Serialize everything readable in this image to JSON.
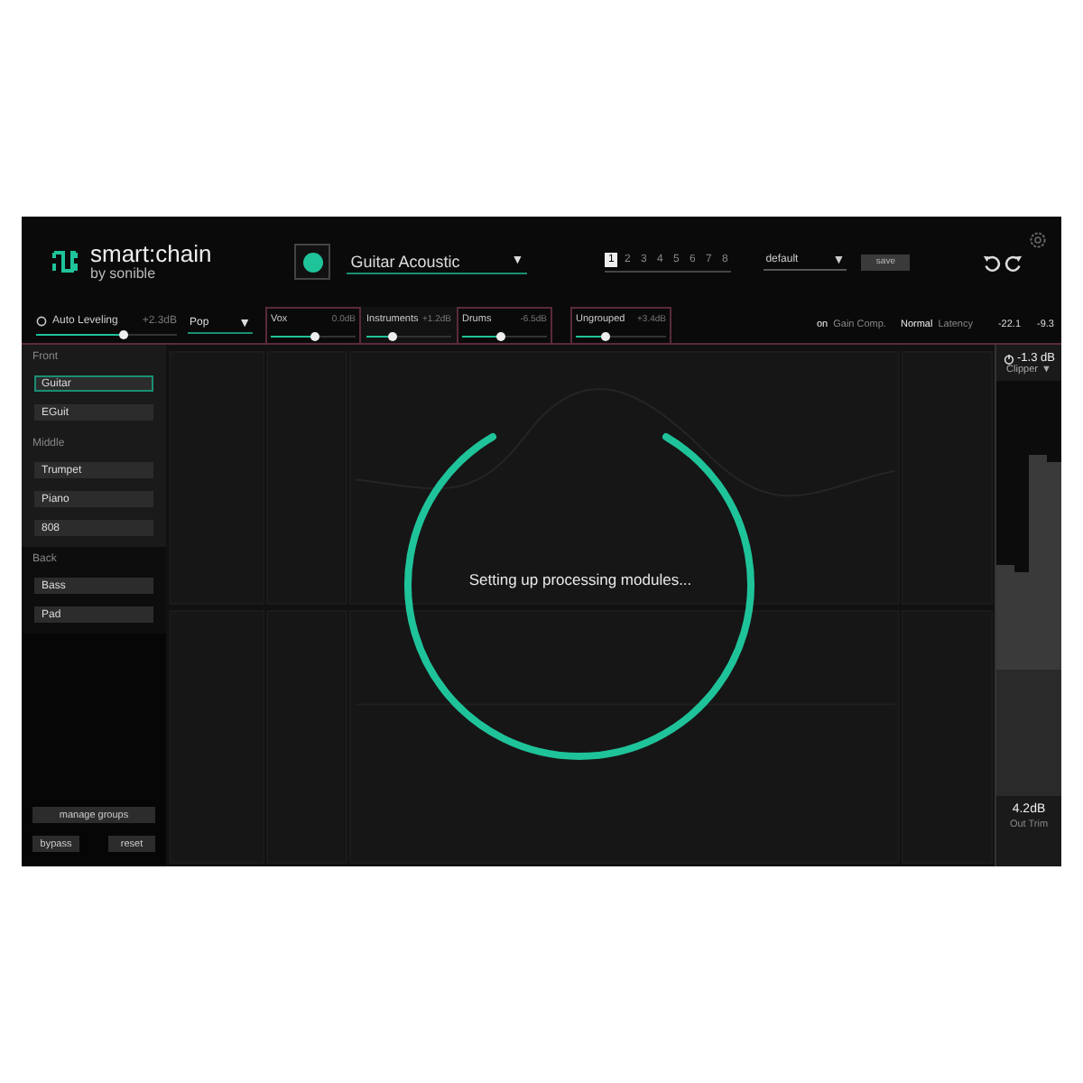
{
  "logo": {
    "name": "smart:chain",
    "byline": "by sonible"
  },
  "preset": {
    "value": "Guitar Acoustic",
    "caret": "▼"
  },
  "pages": [
    {
      "label": "1",
      "selected": true
    },
    {
      "label": "2",
      "selected": false
    },
    {
      "label": "3",
      "selected": false
    },
    {
      "label": "4",
      "selected": false
    },
    {
      "label": "5",
      "selected": false
    },
    {
      "label": "6",
      "selected": false
    },
    {
      "label": "7",
      "selected": false
    },
    {
      "label": "8",
      "selected": false
    }
  ],
  "profile": {
    "value": "default",
    "caret": "▼"
  },
  "save": "save",
  "auto_leveling": {
    "label": "Auto Leveling",
    "value": "+2.3dB",
    "level": 0.62
  },
  "genre": {
    "value": "Pop",
    "caret": "▼"
  },
  "groups": [
    {
      "kind": "group",
      "label": "Vox",
      "value": "0.0dB",
      "level": 0.5,
      "selected": false
    },
    {
      "kind": "group",
      "label": "Instruments",
      "value": "+1.2dB",
      "level": 0.3,
      "selected": true
    },
    {
      "kind": "group",
      "label": "Drums",
      "value": "-6.5dB",
      "level": 0.45,
      "selected": false
    },
    {
      "kind": "ungrouped",
      "label": "Ungrouped",
      "value": "+3.4dB",
      "level": 0.32,
      "selected": false
    }
  ],
  "status": [
    {
      "state": "on",
      "label": "Gain Comp."
    },
    {
      "state": "Normal",
      "label": "Latency"
    }
  ],
  "readings": [
    "-22.1",
    "-9.3"
  ],
  "sidebar": {
    "sections": [
      {
        "title": "Front",
        "active": true,
        "items": [
          {
            "label": "Guitar",
            "selected": true
          },
          {
            "label": "EGuit",
            "selected": false
          }
        ]
      },
      {
        "title": "Middle",
        "active": true,
        "items": [
          {
            "label": "Trumpet",
            "selected": false
          },
          {
            "label": "Piano",
            "selected": false
          },
          {
            "label": "808",
            "selected": false
          }
        ]
      },
      {
        "title": "Back",
        "active": false,
        "items": [
          {
            "label": "Bass",
            "selected": false
          },
          {
            "label": "Pad",
            "selected": false
          }
        ]
      }
    ],
    "manage": "manage groups",
    "bypass": "bypass",
    "reset": "reset"
  },
  "loading": {
    "message": "Setting up processing modules..."
  },
  "output": {
    "value": "-1.3 dB",
    "mode": "Clipper",
    "caret": "▼",
    "trim": "4.2dB",
    "trim_label": "Out Trim"
  }
}
